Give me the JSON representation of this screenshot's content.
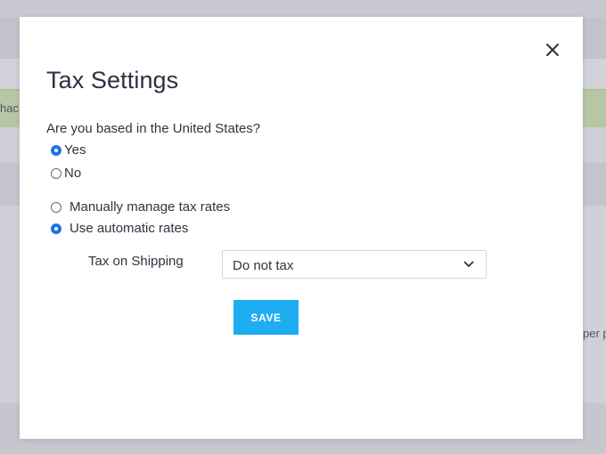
{
  "background": {
    "left_fragment": "hac",
    "right_fragment": "per p"
  },
  "modal": {
    "title": "Tax Settings",
    "close_icon": "close-icon",
    "question": "Are you based in the United States?",
    "location_options": [
      {
        "label": "Yes",
        "checked": true
      },
      {
        "label": "No",
        "checked": false
      }
    ],
    "rate_options": [
      {
        "label": "Manually manage tax rates",
        "checked": false
      },
      {
        "label": "Use automatic rates",
        "checked": true
      }
    ],
    "shipping": {
      "label": "Tax on Shipping",
      "selected": "Do not tax",
      "chevron_icon": "chevron-down-icon"
    },
    "save_label": "SAVE"
  },
  "colors": {
    "accent": "#1fadf2",
    "radio_checked": "#1a73e8",
    "overlay": "#c9c9d2",
    "success_bar": "#b7c6a4"
  }
}
